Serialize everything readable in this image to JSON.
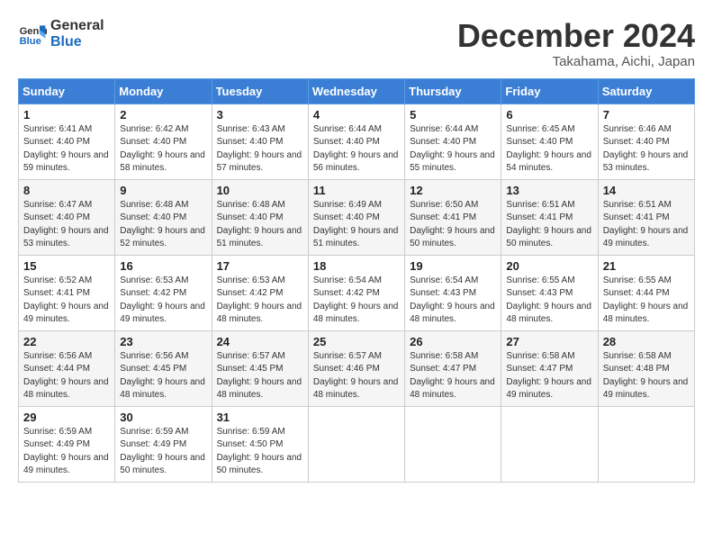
{
  "header": {
    "logo_line1": "General",
    "logo_line2": "Blue",
    "month_title": "December 2024",
    "location": "Takahama, Aichi, Japan"
  },
  "days_of_week": [
    "Sunday",
    "Monday",
    "Tuesday",
    "Wednesday",
    "Thursday",
    "Friday",
    "Saturday"
  ],
  "weeks": [
    [
      {
        "day": "1",
        "sunrise": "6:41 AM",
        "sunset": "4:40 PM",
        "daylight": "9 hours and 59 minutes."
      },
      {
        "day": "2",
        "sunrise": "6:42 AM",
        "sunset": "4:40 PM",
        "daylight": "9 hours and 58 minutes."
      },
      {
        "day": "3",
        "sunrise": "6:43 AM",
        "sunset": "4:40 PM",
        "daylight": "9 hours and 57 minutes."
      },
      {
        "day": "4",
        "sunrise": "6:44 AM",
        "sunset": "4:40 PM",
        "daylight": "9 hours and 56 minutes."
      },
      {
        "day": "5",
        "sunrise": "6:44 AM",
        "sunset": "4:40 PM",
        "daylight": "9 hours and 55 minutes."
      },
      {
        "day": "6",
        "sunrise": "6:45 AM",
        "sunset": "4:40 PM",
        "daylight": "9 hours and 54 minutes."
      },
      {
        "day": "7",
        "sunrise": "6:46 AM",
        "sunset": "4:40 PM",
        "daylight": "9 hours and 53 minutes."
      }
    ],
    [
      {
        "day": "8",
        "sunrise": "6:47 AM",
        "sunset": "4:40 PM",
        "daylight": "9 hours and 53 minutes."
      },
      {
        "day": "9",
        "sunrise": "6:48 AM",
        "sunset": "4:40 PM",
        "daylight": "9 hours and 52 minutes."
      },
      {
        "day": "10",
        "sunrise": "6:48 AM",
        "sunset": "4:40 PM",
        "daylight": "9 hours and 51 minutes."
      },
      {
        "day": "11",
        "sunrise": "6:49 AM",
        "sunset": "4:40 PM",
        "daylight": "9 hours and 51 minutes."
      },
      {
        "day": "12",
        "sunrise": "6:50 AM",
        "sunset": "4:41 PM",
        "daylight": "9 hours and 50 minutes."
      },
      {
        "day": "13",
        "sunrise": "6:51 AM",
        "sunset": "4:41 PM",
        "daylight": "9 hours and 50 minutes."
      },
      {
        "day": "14",
        "sunrise": "6:51 AM",
        "sunset": "4:41 PM",
        "daylight": "9 hours and 49 minutes."
      }
    ],
    [
      {
        "day": "15",
        "sunrise": "6:52 AM",
        "sunset": "4:41 PM",
        "daylight": "9 hours and 49 minutes."
      },
      {
        "day": "16",
        "sunrise": "6:53 AM",
        "sunset": "4:42 PM",
        "daylight": "9 hours and 49 minutes."
      },
      {
        "day": "17",
        "sunrise": "6:53 AM",
        "sunset": "4:42 PM",
        "daylight": "9 hours and 48 minutes."
      },
      {
        "day": "18",
        "sunrise": "6:54 AM",
        "sunset": "4:42 PM",
        "daylight": "9 hours and 48 minutes."
      },
      {
        "day": "19",
        "sunrise": "6:54 AM",
        "sunset": "4:43 PM",
        "daylight": "9 hours and 48 minutes."
      },
      {
        "day": "20",
        "sunrise": "6:55 AM",
        "sunset": "4:43 PM",
        "daylight": "9 hours and 48 minutes."
      },
      {
        "day": "21",
        "sunrise": "6:55 AM",
        "sunset": "4:44 PM",
        "daylight": "9 hours and 48 minutes."
      }
    ],
    [
      {
        "day": "22",
        "sunrise": "6:56 AM",
        "sunset": "4:44 PM",
        "daylight": "9 hours and 48 minutes."
      },
      {
        "day": "23",
        "sunrise": "6:56 AM",
        "sunset": "4:45 PM",
        "daylight": "9 hours and 48 minutes."
      },
      {
        "day": "24",
        "sunrise": "6:57 AM",
        "sunset": "4:45 PM",
        "daylight": "9 hours and 48 minutes."
      },
      {
        "day": "25",
        "sunrise": "6:57 AM",
        "sunset": "4:46 PM",
        "daylight": "9 hours and 48 minutes."
      },
      {
        "day": "26",
        "sunrise": "6:58 AM",
        "sunset": "4:47 PM",
        "daylight": "9 hours and 48 minutes."
      },
      {
        "day": "27",
        "sunrise": "6:58 AM",
        "sunset": "4:47 PM",
        "daylight": "9 hours and 49 minutes."
      },
      {
        "day": "28",
        "sunrise": "6:58 AM",
        "sunset": "4:48 PM",
        "daylight": "9 hours and 49 minutes."
      }
    ],
    [
      {
        "day": "29",
        "sunrise": "6:59 AM",
        "sunset": "4:49 PM",
        "daylight": "9 hours and 49 minutes."
      },
      {
        "day": "30",
        "sunrise": "6:59 AM",
        "sunset": "4:49 PM",
        "daylight": "9 hours and 50 minutes."
      },
      {
        "day": "31",
        "sunrise": "6:59 AM",
        "sunset": "4:50 PM",
        "daylight": "9 hours and 50 minutes."
      },
      null,
      null,
      null,
      null
    ]
  ],
  "labels": {
    "sunrise": "Sunrise:",
    "sunset": "Sunset:",
    "daylight": "Daylight:"
  }
}
